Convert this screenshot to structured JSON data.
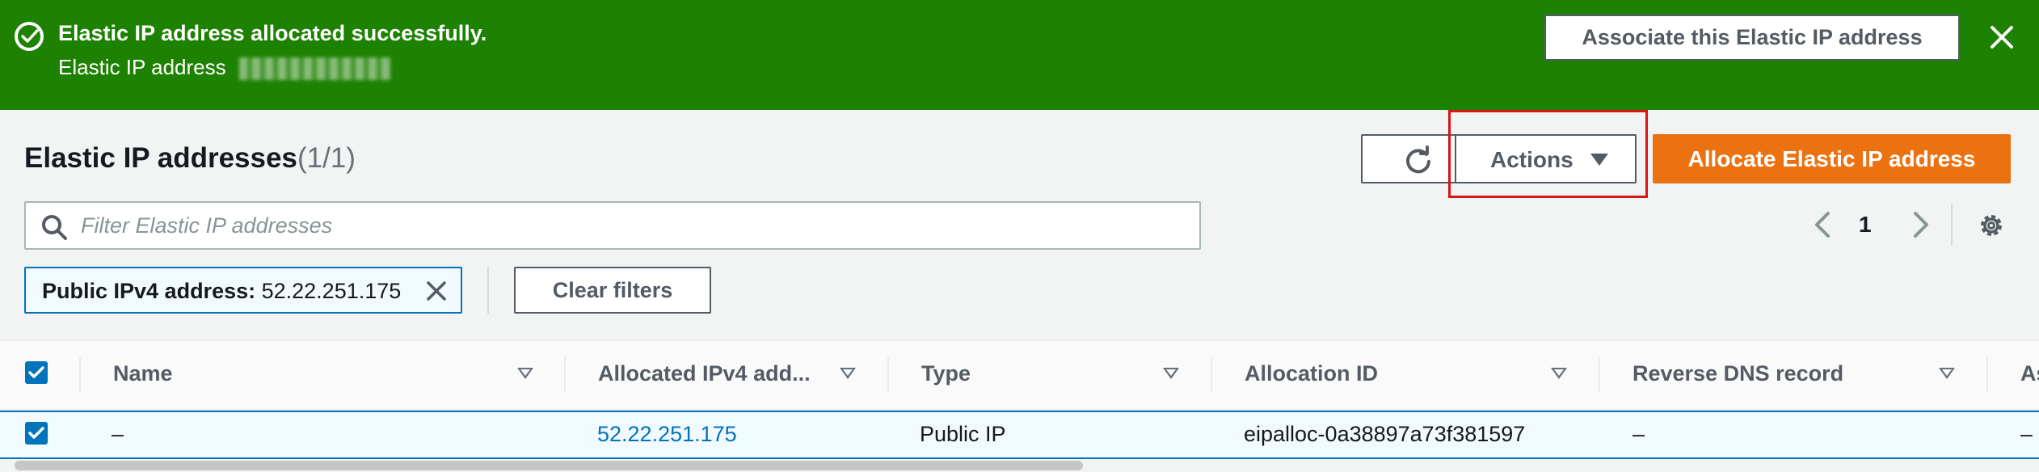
{
  "flash": {
    "title": "Elastic IP address allocated successfully.",
    "subtitle": "Elastic IP address",
    "associate_label": "Associate this Elastic IP address",
    "color": "#1d8102"
  },
  "header": {
    "title": "Elastic IP addresses",
    "count": "(1/1)",
    "actions_label": "Actions",
    "allocate_label": "Allocate Elastic IP address"
  },
  "search": {
    "placeholder": "Filter Elastic IP addresses",
    "value": ""
  },
  "pagination": {
    "page": "1"
  },
  "filters": {
    "token_key": "Public IPv4 address:",
    "token_value": " 52.22.251.175",
    "clear_label": "Clear filters"
  },
  "table": {
    "columns": [
      "Name",
      "Allocated IPv4 add...",
      "Type",
      "Allocation ID",
      "Reverse DNS record",
      "As"
    ],
    "rows": [
      {
        "selected": true,
        "name": "–",
        "ip": "52.22.251.175",
        "type": "Public IP",
        "allocation_id": "eipalloc-0a38897a73f381597",
        "rdns": "–",
        "extra": "–"
      }
    ]
  },
  "icons": {
    "flash": "check-circle-icon",
    "close": "close-icon",
    "refresh": "refresh-icon",
    "search": "search-icon",
    "settings": "gear-icon"
  },
  "colors": {
    "accent": "#0073bb",
    "primary_button": "#ec7211",
    "highlight": "#d91515"
  }
}
